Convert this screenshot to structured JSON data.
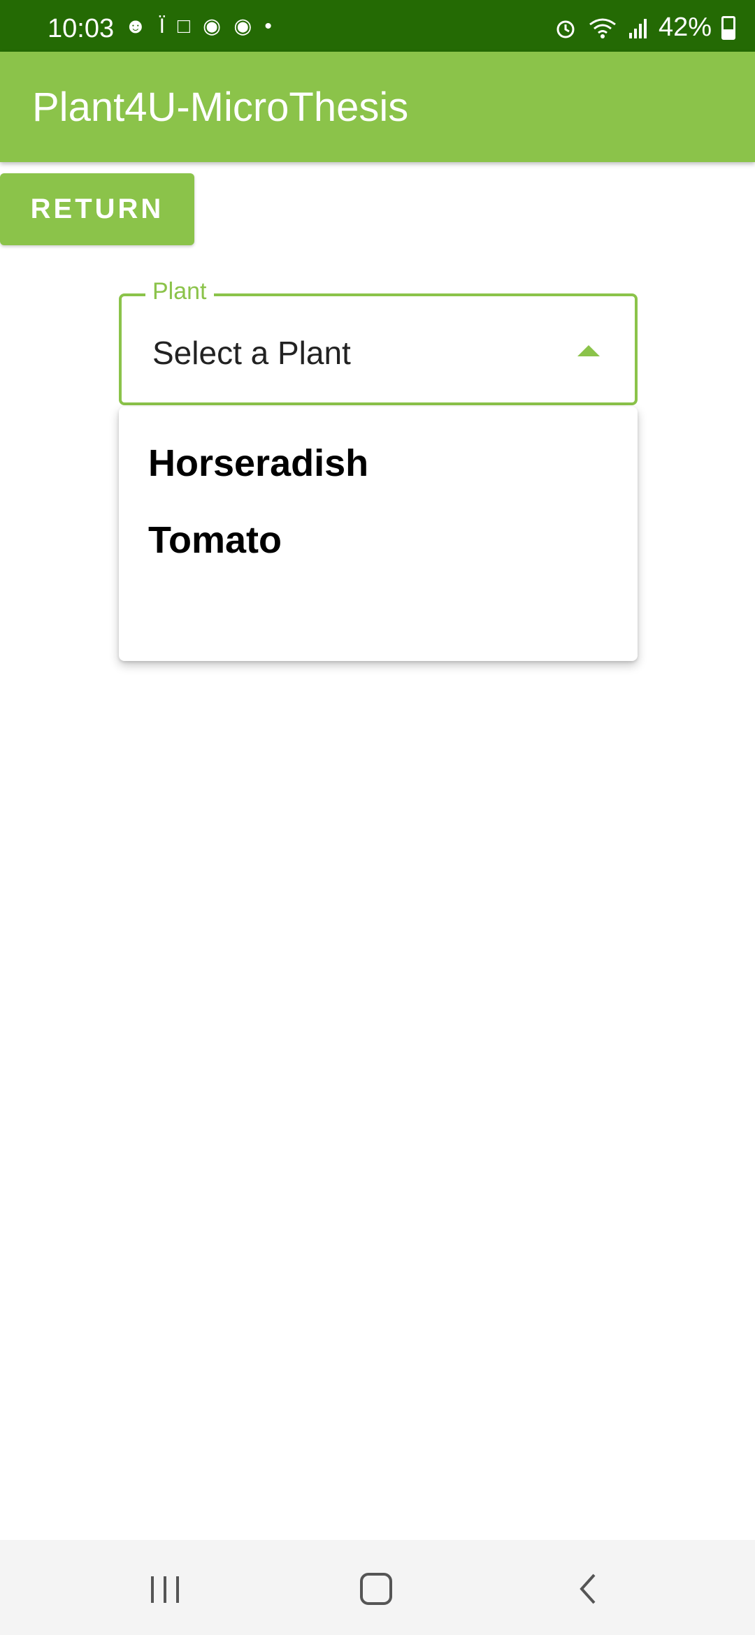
{
  "status_bar": {
    "time": "10:03",
    "battery": "42%",
    "left_icons": [
      "snapchat-icon",
      "threads-icon",
      "webtoon-icon",
      "reddit-icon",
      "reddit-icon",
      "dot-icon"
    ],
    "right_icons": [
      "alarm-icon",
      "wifi-icon",
      "signal-icon"
    ]
  },
  "app_bar": {
    "title": "Plant4U-MicroThesis"
  },
  "return_button": {
    "label": "RETURN"
  },
  "plant_select": {
    "label": "Plant",
    "value": "Select a Plant",
    "options": [
      "Horseradish",
      "Tomato"
    ]
  },
  "colors": {
    "status_bar": "#246a04",
    "accent": "#8bc34a",
    "nav_bar": "#f4f4f4"
  },
  "nav_bar": {
    "buttons": [
      "recents-icon",
      "home-icon",
      "back-icon"
    ]
  }
}
